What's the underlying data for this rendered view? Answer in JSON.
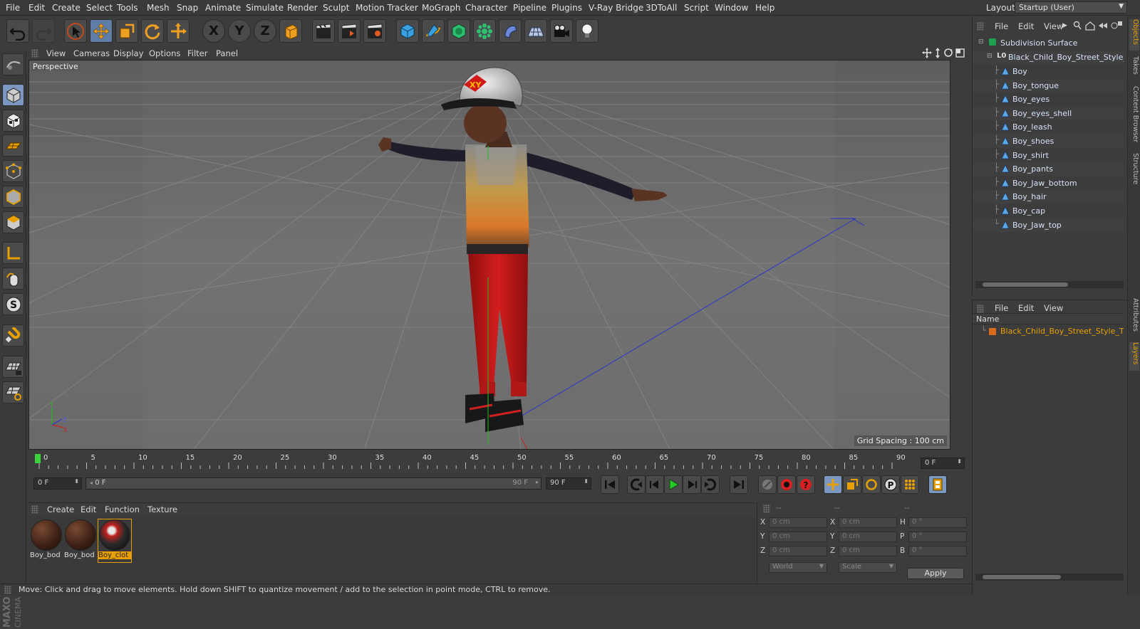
{
  "menu": [
    "File",
    "Edit",
    "Create",
    "Select",
    "Tools",
    "Mesh",
    "Snap",
    "Animate",
    "Simulate",
    "Render",
    "Sculpt",
    "Motion Tracker",
    "MoGraph",
    "Character",
    "Pipeline",
    "Plugins",
    "V-Ray Bridge",
    "3DToAll",
    "Script",
    "Window",
    "Help"
  ],
  "layout": {
    "label": "Layout:",
    "value": "Startup (User)"
  },
  "toolbar": {
    "x_label": "X",
    "y_label": "Y",
    "z_label": "Z"
  },
  "viewport": {
    "menu": [
      "View",
      "Cameras",
      "Display",
      "Options",
      "Filter",
      "Panel"
    ],
    "camera_label": "Perspective",
    "grid_spacing": "Grid Spacing : 100 cm"
  },
  "timeline": {
    "ticks": [
      "0",
      "5",
      "10",
      "15",
      "20",
      "25",
      "30",
      "35",
      "40",
      "45",
      "50",
      "55",
      "60",
      "65",
      "70",
      "75",
      "80",
      "85",
      "90"
    ],
    "current_frame_value": "0 F",
    "start_field": "0 F",
    "slider_start": "0 F",
    "slider_end": "90 F",
    "end_field": "90 F"
  },
  "materials": {
    "menu": [
      "Create",
      "Edit",
      "Function",
      "Texture"
    ],
    "items": [
      {
        "name": "Boy_bod",
        "selected": false
      },
      {
        "name": "Boy_bod",
        "selected": false
      },
      {
        "name": "Boy_clot",
        "selected": true
      }
    ]
  },
  "coords": {
    "headers": [
      "--",
      "--",
      "--"
    ],
    "rows": [
      {
        "a": "X",
        "av": "0 cm",
        "b": "X",
        "bv": "0 cm",
        "c": "H",
        "cv": "0 °"
      },
      {
        "a": "Y",
        "av": "0 cm",
        "b": "Y",
        "bv": "0 cm",
        "c": "P",
        "cv": "0 °"
      },
      {
        "a": "Z",
        "av": "0 cm",
        "b": "Z",
        "bv": "0 cm",
        "c": "B",
        "cv": "0 °"
      }
    ],
    "space": "World",
    "mode": "Scale",
    "apply": "Apply"
  },
  "status": "Move: Click and drag to move elements. Hold down SHIFT to quantize movement / add to the selection in point mode, CTRL to remove.",
  "objects": {
    "menu": [
      "File",
      "Edit",
      "View"
    ],
    "root": "Subdivision Surface",
    "group": "Black_Child_Boy_Street_Style_T_P",
    "children": [
      "Boy",
      "Boy_tongue",
      "Boy_eyes",
      "Boy_eyes_shell",
      "Boy_leash",
      "Boy_shoes",
      "Boy_shirt",
      "Boy_pants",
      "Boy_Jaw_bottom",
      "Boy_hair",
      "Boy_cap",
      "Boy_Jaw_top"
    ]
  },
  "layers": {
    "menu": [
      "File",
      "Edit",
      "View"
    ],
    "column": "Name",
    "item": "Black_Child_Boy_Street_Style_T_Po"
  },
  "side_tabs": [
    "Objects",
    "Takes",
    "Content Browser",
    "Structure",
    "Attributes",
    "Layers"
  ],
  "brand": "MAXON CINEMA 4D",
  "colors": {
    "accent": "#e8a000",
    "selection": "#7d98c0",
    "object_text": "#d6e1f5"
  }
}
